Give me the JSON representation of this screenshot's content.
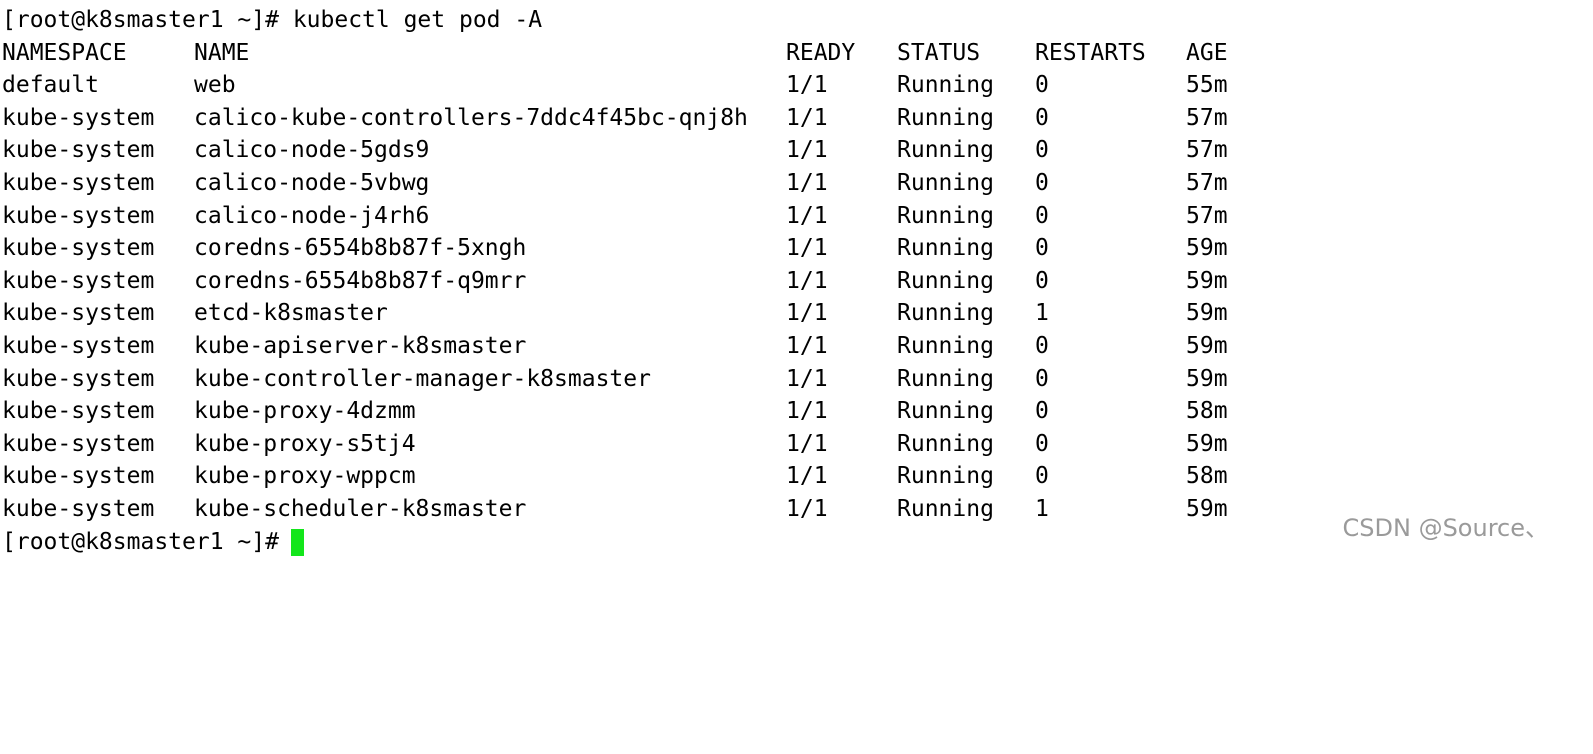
{
  "terminal": {
    "command_line": {
      "prompt": "[root@k8smaster1 ~]#",
      "command": "kubectl get pod -A"
    },
    "headers": {
      "namespace": "NAMESPACE",
      "name": "NAME",
      "ready": "READY",
      "status": "STATUS",
      "restarts": "RESTARTS",
      "age": "AGE"
    },
    "rows": [
      {
        "namespace": "default",
        "name": "web",
        "ready": "1/1",
        "status": "Running",
        "restarts": "0",
        "age": "55m"
      },
      {
        "namespace": "kube-system",
        "name": "calico-kube-controllers-7ddc4f45bc-qnj8h",
        "ready": "1/1",
        "status": "Running",
        "restarts": "0",
        "age": "57m"
      },
      {
        "namespace": "kube-system",
        "name": "calico-node-5gds9",
        "ready": "1/1",
        "status": "Running",
        "restarts": "0",
        "age": "57m"
      },
      {
        "namespace": "kube-system",
        "name": "calico-node-5vbwg",
        "ready": "1/1",
        "status": "Running",
        "restarts": "0",
        "age": "57m"
      },
      {
        "namespace": "kube-system",
        "name": "calico-node-j4rh6",
        "ready": "1/1",
        "status": "Running",
        "restarts": "0",
        "age": "57m"
      },
      {
        "namespace": "kube-system",
        "name": "coredns-6554b8b87f-5xngh",
        "ready": "1/1",
        "status": "Running",
        "restarts": "0",
        "age": "59m"
      },
      {
        "namespace": "kube-system",
        "name": "coredns-6554b8b87f-q9mrr",
        "ready": "1/1",
        "status": "Running",
        "restarts": "0",
        "age": "59m"
      },
      {
        "namespace": "kube-system",
        "name": "etcd-k8smaster",
        "ready": "1/1",
        "status": "Running",
        "restarts": "1",
        "age": "59m"
      },
      {
        "namespace": "kube-system",
        "name": "kube-apiserver-k8smaster",
        "ready": "1/1",
        "status": "Running",
        "restarts": "0",
        "age": "59m"
      },
      {
        "namespace": "kube-system",
        "name": "kube-controller-manager-k8smaster",
        "ready": "1/1",
        "status": "Running",
        "restarts": "0",
        "age": "59m"
      },
      {
        "namespace": "kube-system",
        "name": "kube-proxy-4dzmm",
        "ready": "1/1",
        "status": "Running",
        "restarts": "0",
        "age": "58m"
      },
      {
        "namespace": "kube-system",
        "name": "kube-proxy-s5tj4",
        "ready": "1/1",
        "status": "Running",
        "restarts": "0",
        "age": "59m"
      },
      {
        "namespace": "kube-system",
        "name": "kube-proxy-wppcm",
        "ready": "1/1",
        "status": "Running",
        "restarts": "0",
        "age": "58m"
      },
      {
        "namespace": "kube-system",
        "name": "kube-scheduler-k8smaster",
        "ready": "1/1",
        "status": "Running",
        "restarts": "1",
        "age": "59m"
      }
    ],
    "final_prompt": "[root@k8smaster1 ~]#",
    "cursor_color": "#13e61b"
  },
  "watermark": "CSDN @Source、"
}
